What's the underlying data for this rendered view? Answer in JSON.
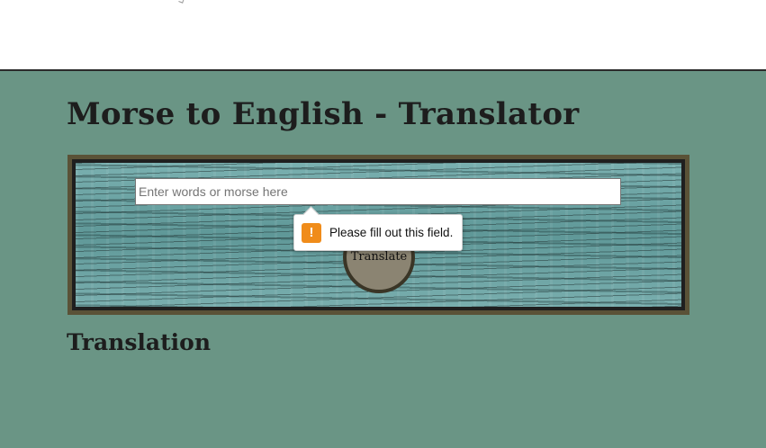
{
  "page": {
    "title": "Morse to English - Translator",
    "subtitle": "Translation"
  },
  "input": {
    "value": "",
    "placeholder": "Enter words or morse here"
  },
  "button": {
    "translate_label": "Translate"
  },
  "validation": {
    "message": "Please fill out this field.",
    "icon": "warning-icon",
    "icon_glyph": "!"
  },
  "colors": {
    "background": "#6a9585",
    "frame": "#5a5237",
    "button": "#8b8472",
    "warning": "#f08c1a",
    "text": "#1d1d1d"
  }
}
